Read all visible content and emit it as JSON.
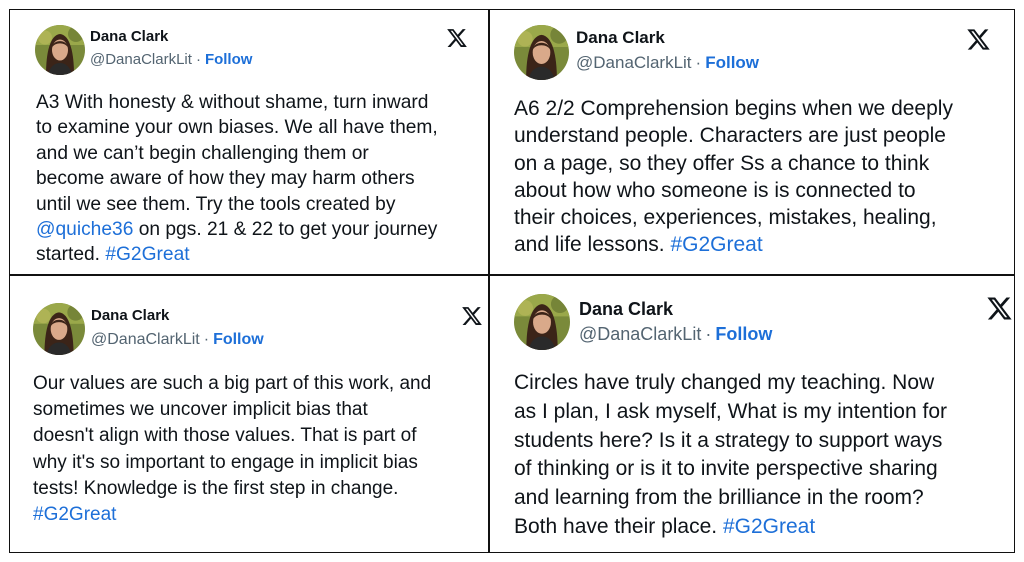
{
  "tweets": [
    {
      "name": "Dana Clark",
      "handle": "@DanaClarkLit",
      "dot": "·",
      "follow": "Follow",
      "logo": "x-logo-icon",
      "lines": [
        [
          {
            "t": "A3 With honesty & without shame, turn inward"
          }
        ],
        [
          {
            "t": "to examine your own biases. We all have them,"
          }
        ],
        [
          {
            "t": "and we can’t begin challenging them or"
          }
        ],
        [
          {
            "t": "become aware of how they may harm others"
          }
        ],
        [
          {
            "t": "until we see them. Try the tools created by"
          }
        ],
        [
          {
            "t": "@quiche36",
            "link": true
          },
          {
            "t": " on pgs. 21 & 22 to get your journey"
          }
        ],
        [
          {
            "t": "started. "
          },
          {
            "t": "#G2Great",
            "link": true
          }
        ]
      ]
    },
    {
      "name": "Dana Clark",
      "handle": "@DanaClarkLit",
      "dot": "·",
      "follow": "Follow",
      "logo": "x-logo-icon",
      "lines": [
        [
          {
            "t": "A6 2/2 Comprehension begins when we deeply"
          }
        ],
        [
          {
            "t": "understand people. Characters are just people"
          }
        ],
        [
          {
            "t": "on a page, so they offer Ss a chance to think"
          }
        ],
        [
          {
            "t": "about how who someone is is connected to"
          }
        ],
        [
          {
            "t": "their choices, experiences, mistakes, healing,"
          }
        ],
        [
          {
            "t": "and life lessons. "
          },
          {
            "t": "#G2Great",
            "link": true
          }
        ]
      ]
    },
    {
      "name": "Dana Clark",
      "handle": "@DanaClarkLit",
      "dot": "·",
      "follow": "Follow",
      "logo": "x-logo-icon",
      "lines": [
        [
          {
            "t": "Our values are such a big part of this work, and"
          }
        ],
        [
          {
            "t": "sometimes we uncover implicit bias that"
          }
        ],
        [
          {
            "t": "doesn't align with those values. That is part of"
          }
        ],
        [
          {
            "t": "why it's so important to engage in implicit bias"
          }
        ],
        [
          {
            "t": "tests! Knowledge is the first step in change."
          }
        ],
        [
          {
            "t": "#G2Great",
            "link": true
          }
        ]
      ]
    },
    {
      "name": "Dana Clark",
      "handle": "@DanaClarkLit",
      "dot": "·",
      "follow": "Follow",
      "logo": "x-logo-icon",
      "lines": [
        [
          {
            "t": "Circles have truly changed my teaching. Now"
          }
        ],
        [
          {
            "t": "as I plan, I ask myself, What is my intention for"
          }
        ],
        [
          {
            "t": "students here? Is it a strategy to support ways"
          }
        ],
        [
          {
            "t": "of thinking or is it to invite perspective sharing"
          }
        ],
        [
          {
            "t": "and learning from the brilliance in the room?"
          }
        ],
        [
          {
            "t": "Both have their place. "
          },
          {
            "t": "#G2Great",
            "link": true
          }
        ]
      ]
    }
  ],
  "colors": {
    "link": "#1d6fd8",
    "text": "#0f1419",
    "muted": "#536471",
    "border": "#111111"
  }
}
